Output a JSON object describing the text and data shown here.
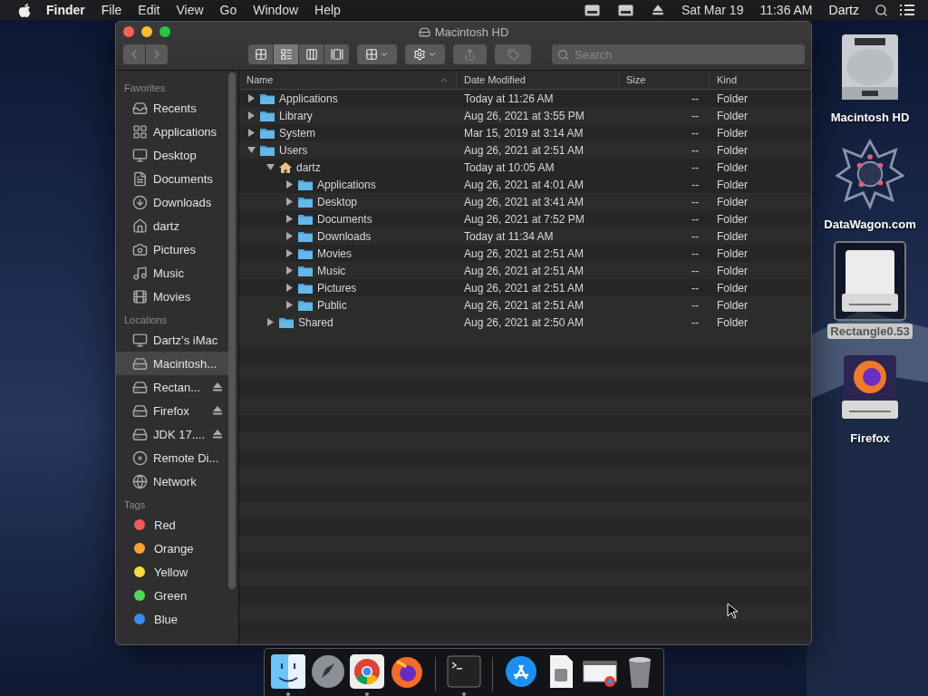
{
  "menu_bar": {
    "app": "Finder",
    "items": [
      "File",
      "Edit",
      "View",
      "Go",
      "Window",
      "Help"
    ],
    "date": "Sat Mar 19",
    "time": "11:36 AM",
    "user": "Dartz"
  },
  "window": {
    "title": "Macintosh HD",
    "view_modes": [
      {
        "selected": false
      },
      {
        "selected": true
      },
      {
        "selected": false
      },
      {
        "selected": false
      }
    ],
    "search": {
      "placeholder": "Search"
    },
    "sidebar": [
      {
        "heading": "Favorites",
        "items": [
          {
            "label": "Recents",
            "selected": false
          },
          {
            "label": "Applications",
            "selected": false
          },
          {
            "label": "Desktop",
            "selected": false
          },
          {
            "label": "Documents",
            "selected": false
          },
          {
            "label": "Downloads",
            "selected": false
          },
          {
            "label": "dartz",
            "selected": false
          },
          {
            "label": "Pictures",
            "selected": false
          },
          {
            "label": "Music",
            "selected": false
          },
          {
            "label": "Movies",
            "selected": false
          }
        ]
      },
      {
        "heading": "Locations",
        "items": [
          {
            "label": "Dartz’s iMac",
            "selected": false,
            "ejectable": false
          },
          {
            "label": "Macintosh...",
            "selected": true,
            "ejectable": false
          },
          {
            "label": "Rectan...",
            "selected": false,
            "ejectable": true
          },
          {
            "label": "Firefox",
            "selected": false,
            "ejectable": true
          },
          {
            "label": "JDK 17....",
            "selected": false,
            "ejectable": true
          },
          {
            "label": "Remote Di...",
            "selected": false,
            "ejectable": false
          },
          {
            "label": "Network",
            "selected": false,
            "ejectable": false
          }
        ]
      },
      {
        "heading": "Tags",
        "items": [
          {
            "label": "Red",
            "selected": false,
            "color": "#f05a5a"
          },
          {
            "label": "Orange",
            "selected": false,
            "color": "#f5a33b"
          },
          {
            "label": "Yellow",
            "selected": false,
            "color": "#f4dc3a"
          },
          {
            "label": "Green",
            "selected": false,
            "color": "#4fd75c"
          },
          {
            "label": "Blue",
            "selected": false,
            "color": "#3b8cf2"
          }
        ]
      }
    ],
    "table": {
      "columns": [
        {
          "label": "Name",
          "sorted": true
        },
        {
          "label": "Date Modified",
          "sorted": false
        },
        {
          "label": "Size",
          "sorted": false
        },
        {
          "label": "Kind",
          "sorted": false
        }
      ],
      "rows": [
        {
          "name": "Applications",
          "date": "Today at 11:26 AM",
          "size": "--",
          "kind_text": "Folder",
          "kind": "folder",
          "expanded": false
        },
        {
          "name": "Library",
          "date": "Aug 26, 2021 at 3:55 PM",
          "size": "--",
          "kind_text": "Folder",
          "kind": "folder",
          "expanded": false
        },
        {
          "name": "System",
          "date": "Mar 15, 2019 at 3:14 AM",
          "size": "--",
          "kind_text": "Folder",
          "kind": "folder",
          "expanded": false
        },
        {
          "name": "Users",
          "date": "Aug 26, 2021 at 2:51 AM",
          "size": "--",
          "kind_text": "Folder",
          "kind": "folder",
          "expanded": true,
          "children": [
            {
              "name": "dartz",
              "date": "Today at 10:05 AM",
              "size": "--",
              "kind_text": "Folder",
              "kind": "home",
              "expanded": true,
              "children": [
                {
                  "name": "Applications",
                  "date": "Aug 26, 2021 at 4:01 AM",
                  "size": "--",
                  "kind_text": "Folder",
                  "kind": "folder",
                  "expanded": false
                },
                {
                  "name": "Desktop",
                  "date": "Aug 26, 2021 at 3:41 AM",
                  "size": "--",
                  "kind_text": "Folder",
                  "kind": "folder",
                  "expanded": false
                },
                {
                  "name": "Documents",
                  "date": "Aug 26, 2021 at 7:52 PM",
                  "size": "--",
                  "kind_text": "Folder",
                  "kind": "folder",
                  "expanded": false
                },
                {
                  "name": "Downloads",
                  "date": "Today at 11:34 AM",
                  "size": "--",
                  "kind_text": "Folder",
                  "kind": "folder",
                  "expanded": false
                },
                {
                  "name": "Movies",
                  "date": "Aug 26, 2021 at 2:51 AM",
                  "size": "--",
                  "kind_text": "Folder",
                  "kind": "folder",
                  "expanded": false
                },
                {
                  "name": "Music",
                  "date": "Aug 26, 2021 at 2:51 AM",
                  "size": "--",
                  "kind_text": "Folder",
                  "kind": "folder",
                  "expanded": false
                },
                {
                  "name": "Pictures",
                  "date": "Aug 26, 2021 at 2:51 AM",
                  "size": "--",
                  "kind_text": "Folder",
                  "kind": "folder",
                  "expanded": false
                },
                {
                  "name": "Public",
                  "date": "Aug 26, 2021 at 2:51 AM",
                  "size": "--",
                  "kind_text": "Folder",
                  "kind": "folder",
                  "expanded": false
                }
              ]
            },
            {
              "name": "Shared",
              "date": "Aug 26, 2021 at 2:50 AM",
              "size": "--",
              "kind_text": "Folder",
              "kind": "folder",
              "expanded": false
            }
          ]
        }
      ]
    }
  },
  "desktop_icons": [
    {
      "label": "Macintosh HD",
      "kind": "disk",
      "selected": false
    },
    {
      "label": "DataWagon.com",
      "selected": false
    },
    {
      "label": "Rectangle0.53",
      "kind": "drive",
      "selected": true
    },
    {
      "label": "Firefox",
      "kind": "appdrive",
      "selected": false
    }
  ],
  "dock": {
    "groups": [
      [
        {
          "kind": "finder",
          "running": true
        },
        {
          "kind": "launchpad",
          "running": false
        },
        {
          "kind": "chrome",
          "running": true
        },
        {
          "kind": "firefox",
          "running": false
        }
      ],
      [
        {
          "kind": "terminal",
          "running": true
        }
      ],
      [
        {
          "kind": "appstore",
          "running": false
        },
        {
          "kind": "preview",
          "running": false
        },
        {
          "kind": "screenshot",
          "running": false
        },
        {
          "kind": "trash",
          "running": false
        }
      ]
    ]
  }
}
